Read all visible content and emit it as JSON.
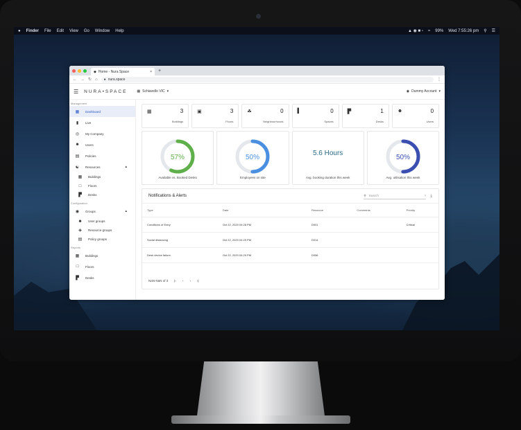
{
  "menubar": {
    "app": "Finder",
    "menus": [
      "File",
      "Edit",
      "View",
      "Go",
      "Window",
      "Help"
    ],
    "battery": "99%",
    "clock": "Wed 7:55:26 pm"
  },
  "browser": {
    "tab_title": "Home - Nura Space",
    "address": "nura.space"
  },
  "app": {
    "logo": "NURA•SPACE",
    "site": "Schiavello VIC",
    "account": "Dummy Account"
  },
  "sidebar": {
    "management_label": "Management",
    "configuration_label": "Configuration",
    "reports_label": "Reports",
    "dashboard": "Dashboard",
    "live": "Live",
    "my_company": "My Company",
    "users": "Users",
    "policies": "Policies",
    "resources": "Resources",
    "res_buildings": "Buildings",
    "res_floors": "Floors",
    "res_desks": "Desks",
    "groups": "Groups",
    "user_groups": "User groups",
    "resource_groups": "Resource groups",
    "policy_groups": "Policy groups",
    "rep_buildings": "Buildings",
    "rep_floors": "Floors",
    "rep_desks": "Desks"
  },
  "stats": [
    {
      "value": "3",
      "label": "Buildings"
    },
    {
      "value": "3",
      "label": "Floors"
    },
    {
      "value": "0",
      "label": "Neighbourhoods"
    },
    {
      "value": "0",
      "label": "Spaces"
    },
    {
      "value": "1",
      "label": "Desks"
    },
    {
      "value": "0",
      "label": "Users"
    }
  ],
  "gauges": [
    {
      "text": "57%",
      "label": "Available vs. Booked Desks",
      "fraction": 0.57,
      "color": "#5fb04a"
    },
    {
      "text": "50%",
      "label": "Employees on site",
      "fraction": 0.5,
      "color": "#4a8fe0"
    },
    {
      "text": "5.6 Hours",
      "label": "Avg. booking duration this week"
    },
    {
      "text": "50%",
      "label": "Avg. utilisation this week",
      "fraction": 0.5,
      "color": "#3b4fb0"
    }
  ],
  "notifications": {
    "title": "Notifications & Alerts",
    "search_placeholder": "Search",
    "columns": [
      "Type",
      "Date",
      "Resource",
      "Comments",
      "Priority"
    ],
    "rows": [
      [
        "Conditions of Entry",
        "Oct 22, 2020 04:28 PM",
        "D001",
        "",
        "Critical"
      ],
      [
        "Social distancing",
        "Oct 22, 2020 04:29 PM",
        "D014",
        "",
        ""
      ],
      [
        "Desk device failure",
        "Oct 22, 2020 04:29 PM",
        "D056",
        "",
        ""
      ]
    ],
    "pager": "NaN-NaN of 3"
  },
  "colors": {
    "accent": "#2a59c8",
    "green": "#5fb04a",
    "blue": "#4a8fe0",
    "indigo": "#3b4fb0",
    "teal_text": "#2a6b86"
  }
}
